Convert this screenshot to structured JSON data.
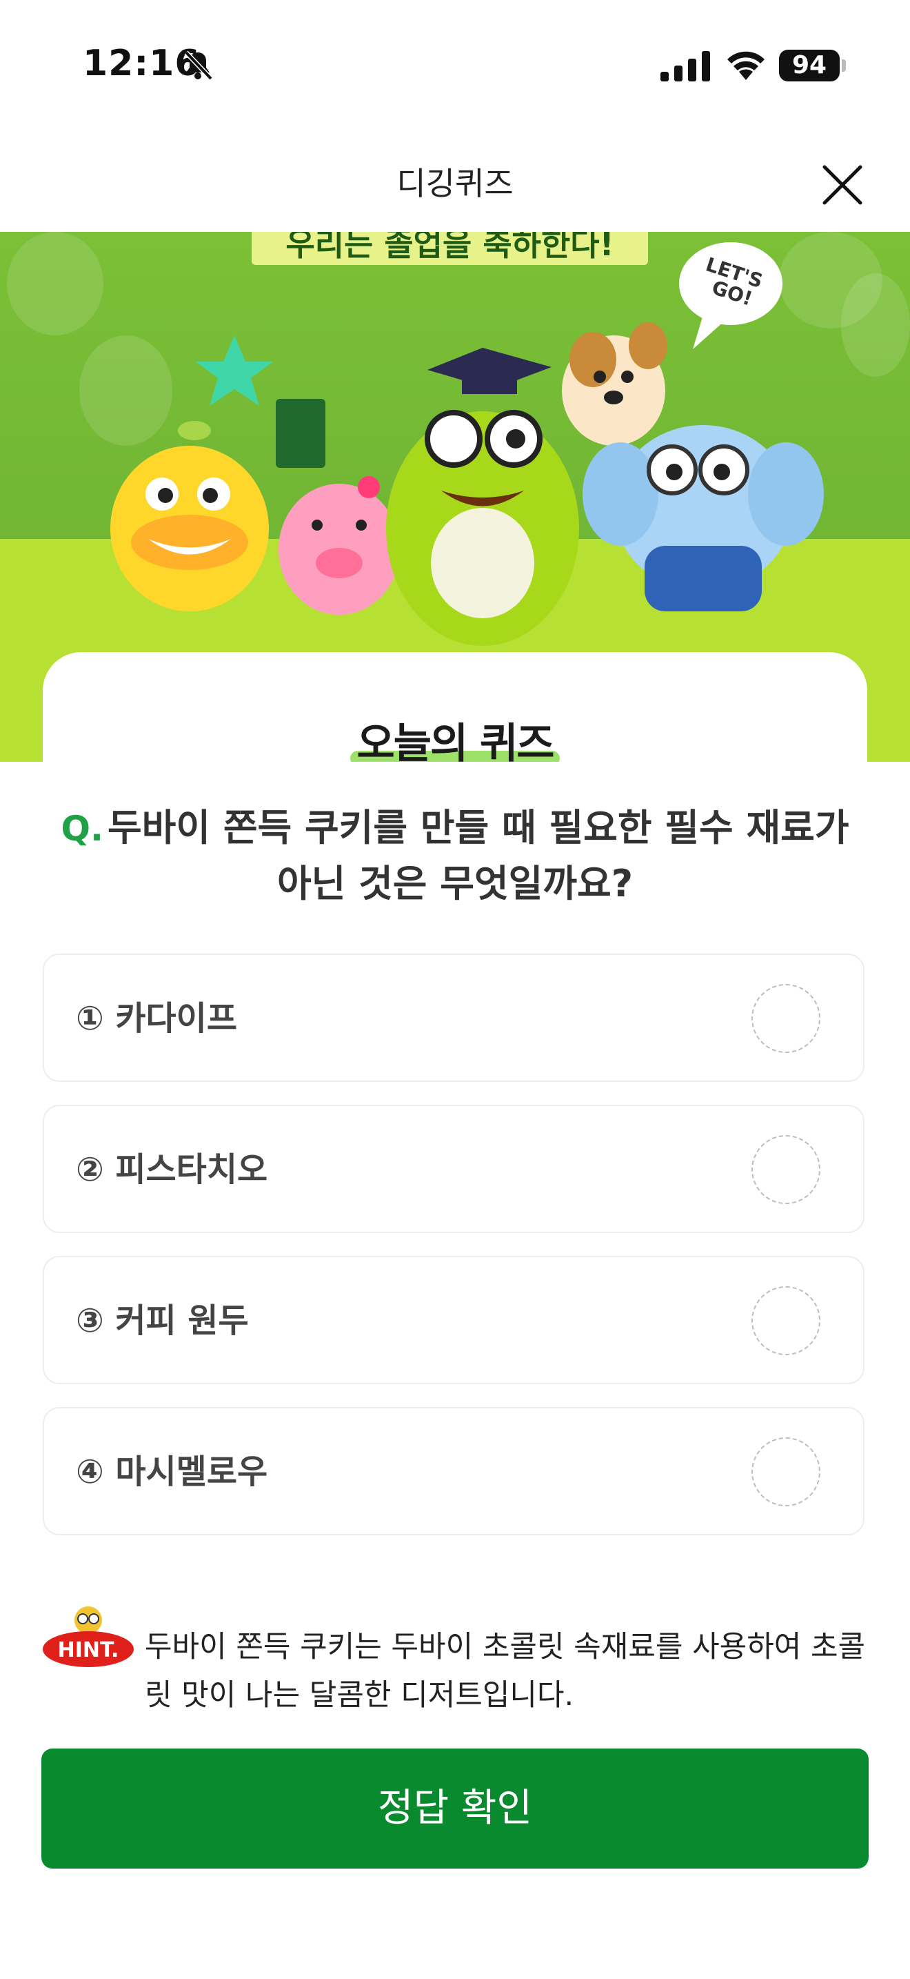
{
  "status_bar": {
    "time": "12:16",
    "battery": "94",
    "icons": [
      "bell-slash-icon",
      "cellular-signal-icon",
      "wifi-icon",
      "battery-icon"
    ]
  },
  "nav": {
    "title": "디깅퀴즈",
    "close_icon": "close-icon"
  },
  "banner": {
    "slogan": "우리는 졸업을 축하한다!",
    "speech_bubble": "LET'S GO!"
  },
  "card": {
    "heading": "오늘의 퀴즈"
  },
  "question": {
    "prefix": "Q.",
    "text": "두바이 쫀득 쿠키를 만들 때 필요한 필수 재료가 아닌 것은 무엇일까요?"
  },
  "options": [
    {
      "label": "① 카다이프",
      "selected": false
    },
    {
      "label": "② 피스타치오",
      "selected": false
    },
    {
      "label": "③ 커피 원두",
      "selected": false
    },
    {
      "label": "④ 마시멜로우",
      "selected": false
    }
  ],
  "hint": {
    "badge": "HINT.",
    "text": "두바이 쫀득 쿠키는 두바이 초콜릿 속재료를 사용하여 초콜릿 맛이 나는 달콤한 디저트입니다."
  },
  "confirm_button": {
    "label": "정답 확인"
  },
  "colors": {
    "accent_green": "#0a8a2e",
    "question_mark_green": "#20a146",
    "banner_light_green": "#b6e033",
    "banner_dark_green": "#74b834",
    "hint_red": "#e0201b"
  }
}
